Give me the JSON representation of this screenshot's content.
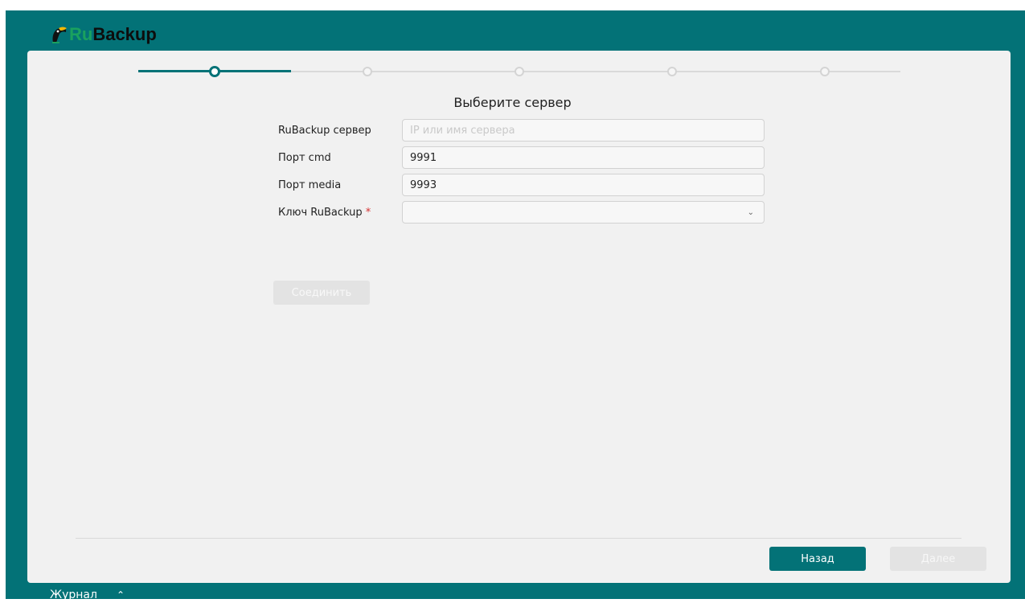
{
  "app": {
    "logo_ru": "Ru",
    "logo_backup": "Backup"
  },
  "stepper": {
    "total_steps": 5,
    "current_step": 1
  },
  "form": {
    "title": "Выберите сервер",
    "server_label": "RuBackup сервер",
    "server_value": "",
    "server_placeholder": "IP или имя сервера",
    "cmd_port_label": "Порт cmd",
    "cmd_port_value": "9991",
    "media_port_label": "Порт media",
    "media_port_value": "9993",
    "key_label": "Ключ RuBackup",
    "key_required_mark": "*",
    "key_selected": "",
    "connect_button": "Соединить"
  },
  "footer": {
    "back_button": "Назад",
    "next_button": "Далее"
  },
  "status_bar": {
    "journal_label": "Журнал"
  },
  "colors": {
    "brand_teal": "#037277",
    "logo_green": "#1aa15f",
    "required_red": "#d63232"
  },
  "icons": {
    "logo": "toucan-logo-icon",
    "select_arrow": "chevron-down-icon",
    "journal_toggle": "chevron-up-icon"
  }
}
